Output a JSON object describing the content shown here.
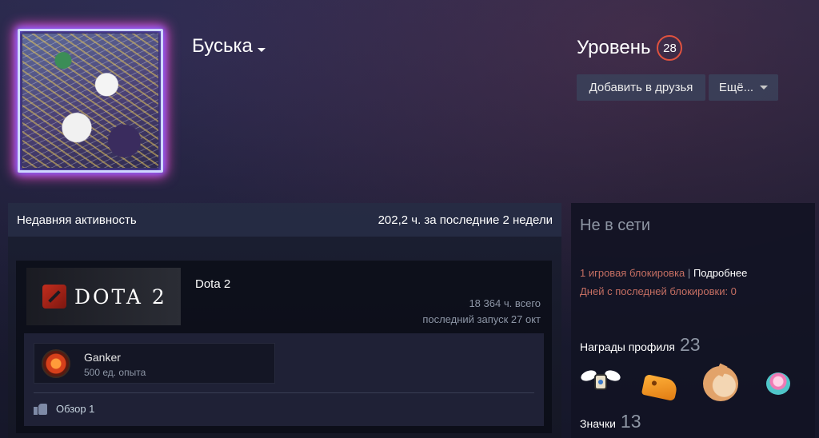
{
  "profile": {
    "persona_name": "Буська",
    "level_label": "Уровень",
    "level_value": "28",
    "add_friend_label": "Добавить в друзья",
    "more_label": "Ещё..."
  },
  "activity": {
    "title": "Недавняя активность",
    "hours_summary": "202,2 ч. за последние 2 недели",
    "game": {
      "logo_text": "DOTA 2",
      "name": "Dota 2",
      "total_hours": "18 364 ч. всего",
      "last_played": "последний запуск 27 окт"
    },
    "achievement": {
      "title": "Ganker",
      "xp": "500 ед. опыта"
    },
    "review_label": "Обзор 1"
  },
  "sidebar": {
    "status": "Не в сети",
    "ban_text": "1 игровая блокировка",
    "ban_sep": "|",
    "ban_more": "Подробнее",
    "ban_days": "Дней с последней блокировки: 0",
    "rewards_label": "Награды профиля",
    "rewards_count": "23",
    "badges_label": "Значки",
    "badges_count": "13"
  },
  "colors": {
    "level_ring": "#e0523f",
    "ban_text": "#c46e62",
    "avatar_glow": "#ff4fd0"
  },
  "icons": [
    "caret-down-icon",
    "dota-logo-icon",
    "achievement-icon",
    "thumbs-up-icon",
    "reward-badge-icons"
  ]
}
